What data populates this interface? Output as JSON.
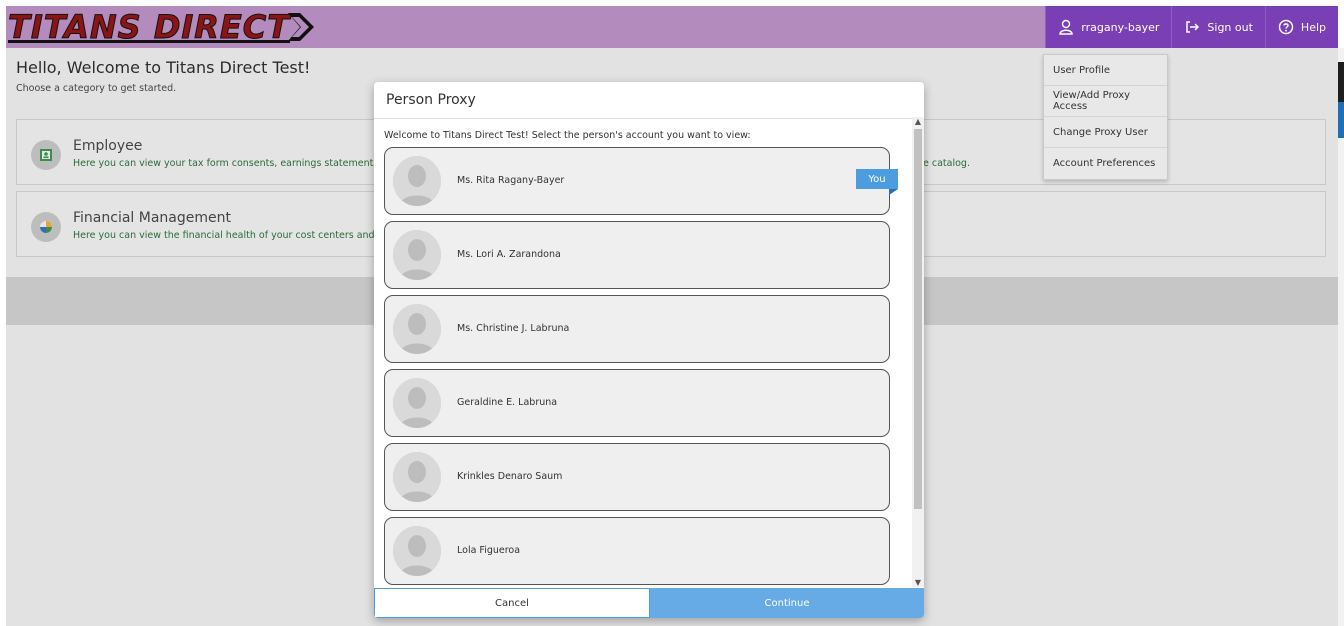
{
  "header": {
    "logo_text": "TITANS DIRECT",
    "user_label": "rragany-bayer",
    "sign_out_label": "Sign out",
    "help_label": "Help"
  },
  "page": {
    "welcome_title": "Hello, Welcome to Titans Direct Test!",
    "welcome_subtitle": "Choose a category to get started.",
    "categories": [
      {
        "title": "Employee",
        "description": "Here you can view your tax form consents, earnings statements,",
        "description_tail": "e catalog."
      },
      {
        "title": "Financial Management",
        "description": "Here you can view the financial health of your cost centers and y"
      }
    ]
  },
  "dropdown": {
    "items": [
      "User Profile",
      "View/Add Proxy Access",
      "Change Proxy User",
      "Account Preferences"
    ]
  },
  "modal": {
    "title": "Person Proxy",
    "intro": "Welcome to Titans Direct Test! Select the person's account you want to view:",
    "you_label": "You",
    "people": [
      "Ms. Rita Ragany-Bayer",
      "Ms. Lori A. Zarandona",
      "Ms. Christine J. Labruna",
      "Geraldine E. Labruna",
      "Krinkles Denaro Saum",
      "Lola Figueroa"
    ],
    "cancel_label": "Cancel",
    "continue_label": "Continue"
  },
  "colors": {
    "header_bg": "#b48bbd",
    "header_buttons": "#7a3fb5",
    "accent_blue": "#4d9ce0",
    "logo_red": "#8b1515"
  },
  "icons": [
    "user-icon",
    "sign-out-icon",
    "help-icon",
    "employee-icon",
    "financial-icon",
    "avatar-placeholder-icon"
  ]
}
